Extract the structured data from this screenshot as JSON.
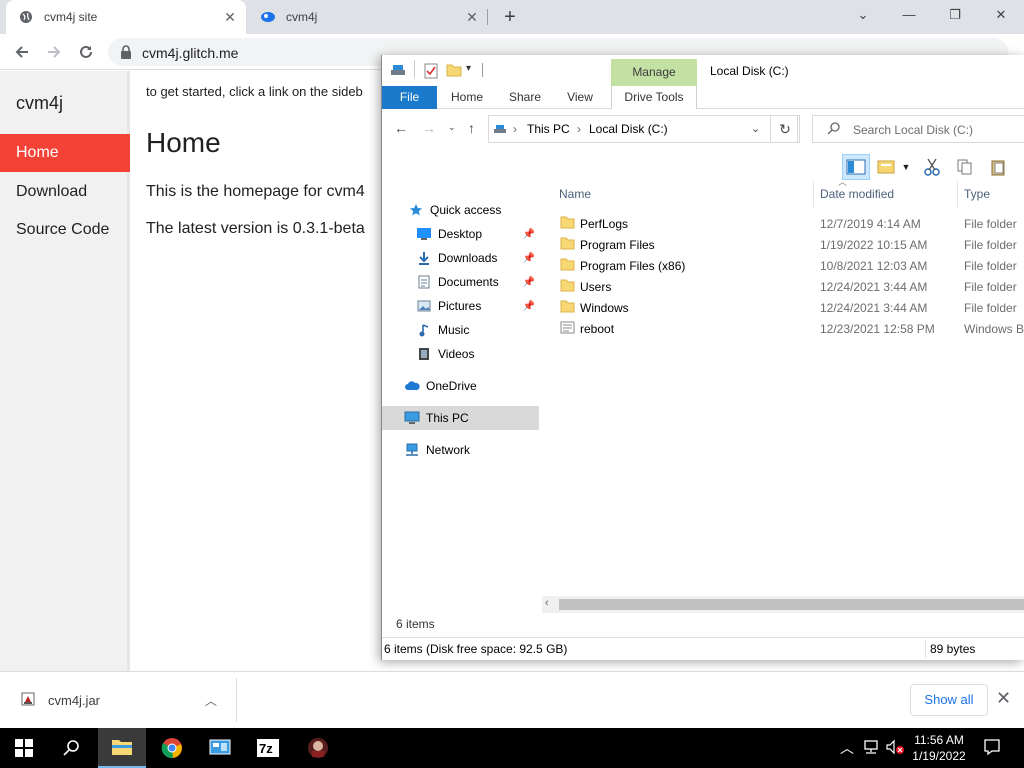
{
  "browser": {
    "tabs": [
      {
        "title": "cvm4j site"
      },
      {
        "title": "cvm4j"
      }
    ],
    "url": "cvm4j.glitch.me"
  },
  "site": {
    "brand": "cvm4j",
    "nav": [
      {
        "label": "Home"
      },
      {
        "label": "Download"
      },
      {
        "label": "Source Code"
      }
    ],
    "intro": "to get started, click a link on the sideb",
    "heading": "Home",
    "para1": "This is the homepage for cvm4",
    "para2": "The latest version is 0.3.1-beta"
  },
  "download_bar": {
    "file": "cvm4j.jar",
    "show_all": "Show all"
  },
  "explorer": {
    "context_tab": "Manage",
    "window_title": "Local Disk (C:)",
    "ribbon_tabs": [
      "File",
      "Home",
      "Share",
      "View",
      "Drive Tools"
    ],
    "breadcrumb": [
      "This PC",
      "Local Disk (C:)"
    ],
    "search_placeholder": "Search Local Disk (C:)",
    "nav_pane": [
      {
        "label": "Quick access",
        "icon": "star-icon"
      },
      {
        "label": "Desktop",
        "icon": "desktop-icon",
        "pinned": true
      },
      {
        "label": "Downloads",
        "icon": "download-arrow-icon",
        "pinned": true
      },
      {
        "label": "Documents",
        "icon": "documents-icon",
        "pinned": true
      },
      {
        "label": "Pictures",
        "icon": "pictures-icon",
        "pinned": true
      },
      {
        "label": "Music",
        "icon": "music-note-icon"
      },
      {
        "label": "Videos",
        "icon": "videos-icon"
      },
      {
        "label": "OneDrive",
        "icon": "cloud-icon"
      },
      {
        "label": "This PC",
        "icon": "computer-icon",
        "selected": true
      },
      {
        "label": "Network",
        "icon": "network-icon"
      }
    ],
    "columns": [
      "Name",
      "Date modified",
      "Type"
    ],
    "files": [
      {
        "name": "PerfLogs",
        "date": "12/7/2019 4:14 AM",
        "type": "File folder",
        "icon": "folder-icon"
      },
      {
        "name": "Program Files",
        "date": "1/19/2022 10:15 AM",
        "type": "File folder",
        "icon": "folder-icon"
      },
      {
        "name": "Program Files (x86)",
        "date": "10/8/2021 12:03 AM",
        "type": "File folder",
        "icon": "folder-icon"
      },
      {
        "name": "Users",
        "date": "12/24/2021 3:44 AM",
        "type": "File folder",
        "icon": "folder-icon"
      },
      {
        "name": "Windows",
        "date": "12/24/2021 3:44 AM",
        "type": "File folder",
        "icon": "folder-icon"
      },
      {
        "name": "reboot",
        "date": "12/23/2021 12:58 PM",
        "type": "Windows Ba",
        "icon": "batch-file-icon"
      }
    ],
    "item_count": "6 items",
    "status_left": "6 items (Disk free space: 92.5 GB)",
    "status_right": "89 bytes"
  },
  "taskbar": {
    "time": "11:56 AM",
    "date": "1/19/2022"
  },
  "colors": {
    "active_nav": "#f44336",
    "ribbon_file_tab": "#1979ca",
    "context_tab": "#c4e1a4",
    "taskbar": "#000000"
  }
}
